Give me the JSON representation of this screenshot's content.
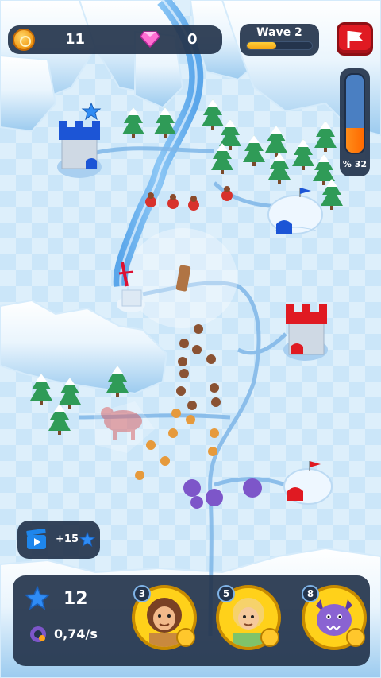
{
  "hud": {
    "coins": "11",
    "gems": "0",
    "wave_label": "Wave 2",
    "wave_progress": 0.45,
    "base_health_text": "% 32",
    "base_health": 0.32
  },
  "reward": {
    "label": "+15"
  },
  "bottom": {
    "stars": "12",
    "rate": "0,74/s"
  },
  "heroes": [
    {
      "level": "3",
      "name": "caveman",
      "badge_icon": "sword-icon"
    },
    {
      "level": "5",
      "name": "archer",
      "badge_icon": "target-icon"
    },
    {
      "level": "8",
      "name": "purple-beast",
      "badge_icon": "shield-icon"
    }
  ],
  "colors": {
    "hud_bg": "#24344c",
    "enemy_red": "#e01a22",
    "ally_blue": "#1c55d6",
    "ice": "#cbe6f9"
  }
}
